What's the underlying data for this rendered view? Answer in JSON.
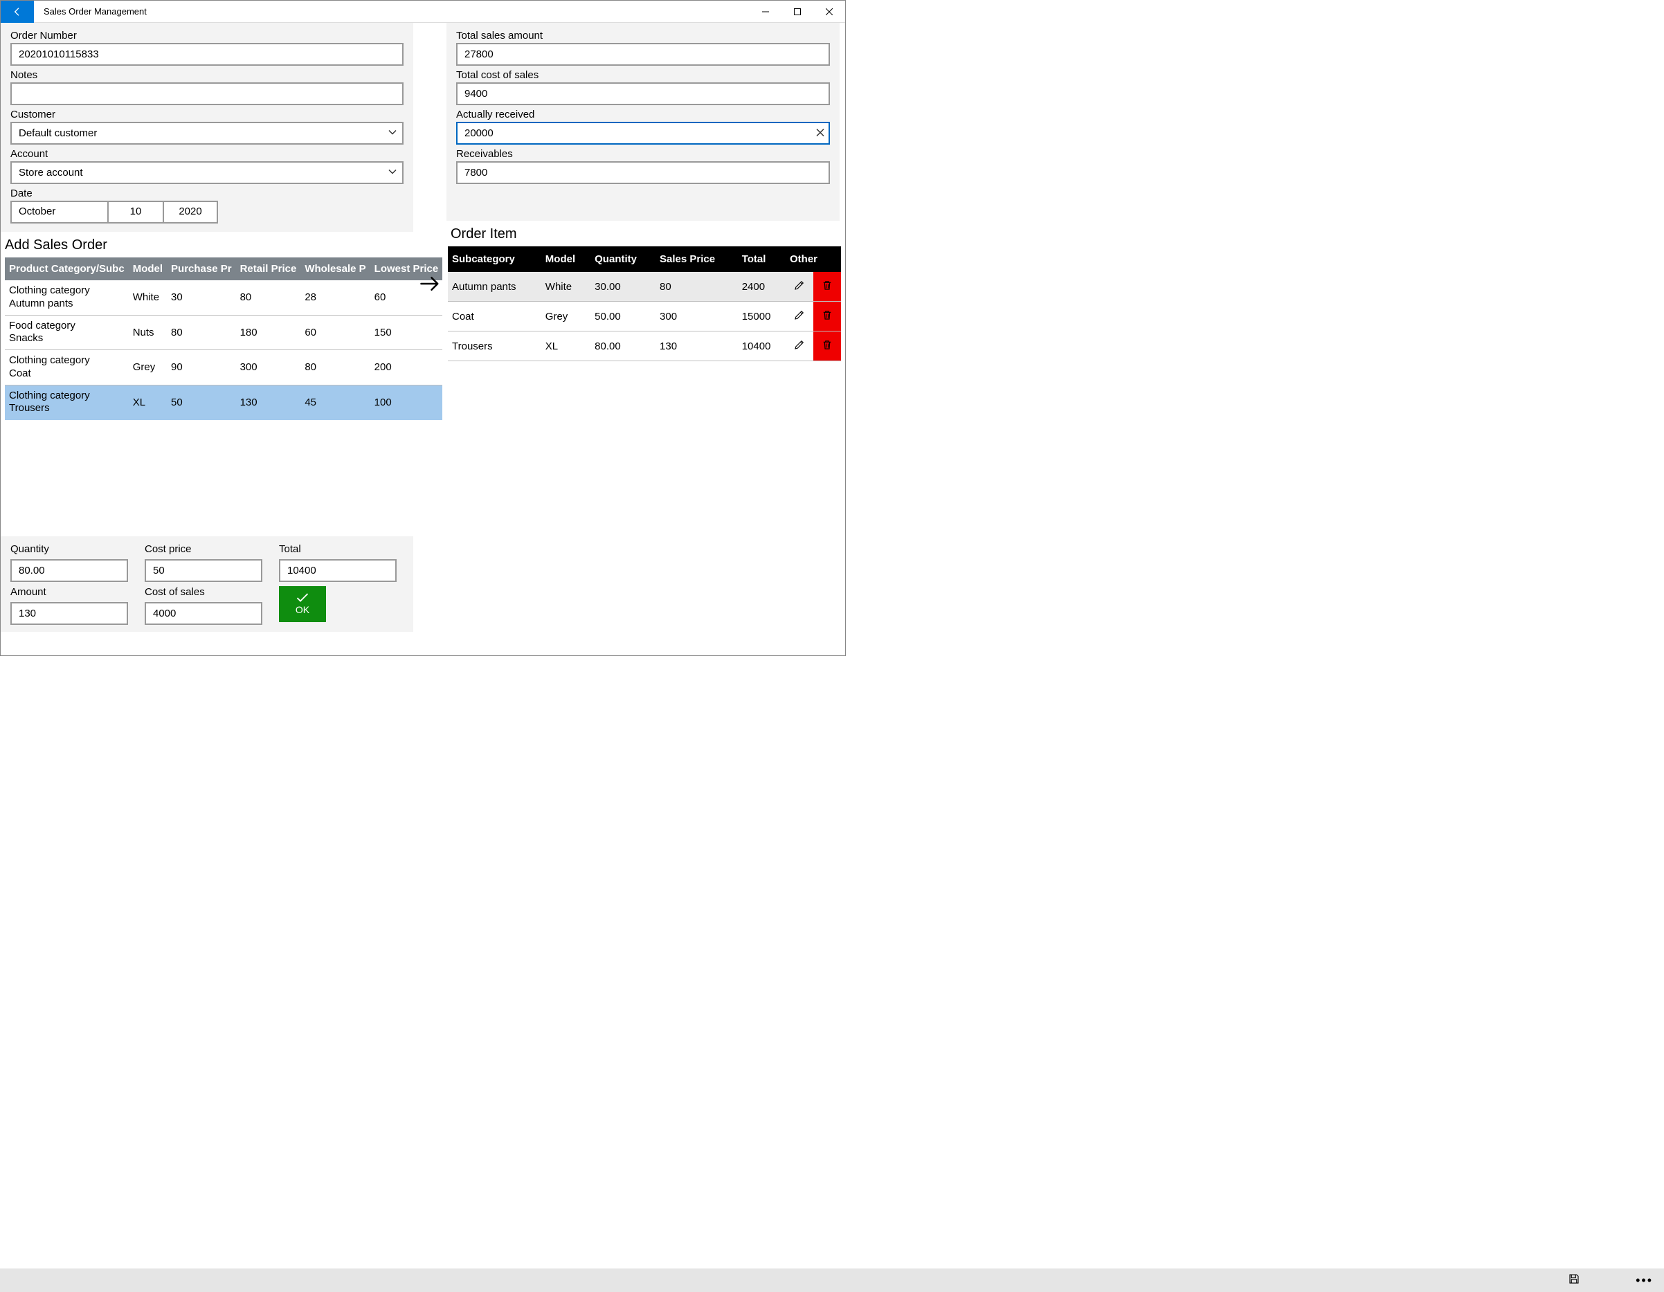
{
  "window": {
    "title": "Sales Order Management"
  },
  "form_left": {
    "order_number_label": "Order Number",
    "order_number_value": "20201010115833",
    "notes_label": "Notes",
    "notes_value": "",
    "customer_label": "Customer",
    "customer_value": "Default customer",
    "account_label": "Account",
    "account_value": "Store account",
    "date_label": "Date",
    "date_month": "October",
    "date_day": "10",
    "date_year": "2020"
  },
  "form_right": {
    "total_sales_label": "Total sales amount",
    "total_sales_value": "27800",
    "total_cost_label": "Total cost of sales",
    "total_cost_value": "9400",
    "received_label": "Actually received",
    "received_value": "20000",
    "receivables_label": "Receivables",
    "receivables_value": "7800"
  },
  "add_sales_order": {
    "heading": "Add Sales Order",
    "col_catsub": "Product Category/Subc",
    "col_model": "Model",
    "col_purchase": "Purchase Pr",
    "col_retail": "Retail Price",
    "col_wholesale": "Wholesale P",
    "col_lowest": "Lowest Price",
    "rows": [
      {
        "cat": "Clothing category",
        "sub": "Autumn pants",
        "model": "White",
        "purchase": "30",
        "retail": "80",
        "wholesale": "28",
        "lowest": "60",
        "selected": false
      },
      {
        "cat": "Food category",
        "sub": "Snacks",
        "model": "Nuts",
        "purchase": "80",
        "retail": "180",
        "wholesale": "60",
        "lowest": "150",
        "selected": false
      },
      {
        "cat": "Clothing category",
        "sub": "Coat",
        "model": "Grey",
        "purchase": "90",
        "retail": "300",
        "wholesale": "80",
        "lowest": "200",
        "selected": false
      },
      {
        "cat": "Clothing category",
        "sub": "Trousers",
        "model": "XL",
        "purchase": "50",
        "retail": "130",
        "wholesale": "45",
        "lowest": "100",
        "selected": true
      }
    ]
  },
  "order_item": {
    "heading": "Order Item",
    "col_sub": "Subcategory",
    "col_model": "Model",
    "col_qty": "Quantity",
    "col_price": "Sales Price",
    "col_total": "Total",
    "col_other": "Other",
    "rows": [
      {
        "sub": "Autumn pants",
        "model": "White",
        "qty": "30.00",
        "price": "80",
        "total": "2400",
        "alt": true
      },
      {
        "sub": "Coat",
        "model": "Grey",
        "qty": "50.00",
        "price": "300",
        "total": "15000",
        "alt": false
      },
      {
        "sub": "Trousers",
        "model": "XL",
        "qty": "80.00",
        "price": "130",
        "total": "10400",
        "alt": false
      }
    ]
  },
  "qty": {
    "quantity_label": "Quantity",
    "quantity_value": "80.00",
    "costprice_label": "Cost price",
    "costprice_value": "50",
    "total_label": "Total",
    "total_value": "10400",
    "amount_label": "Amount",
    "amount_value": "130",
    "costsales_label": "Cost of sales",
    "costsales_value": "4000",
    "ok_label": "OK"
  }
}
